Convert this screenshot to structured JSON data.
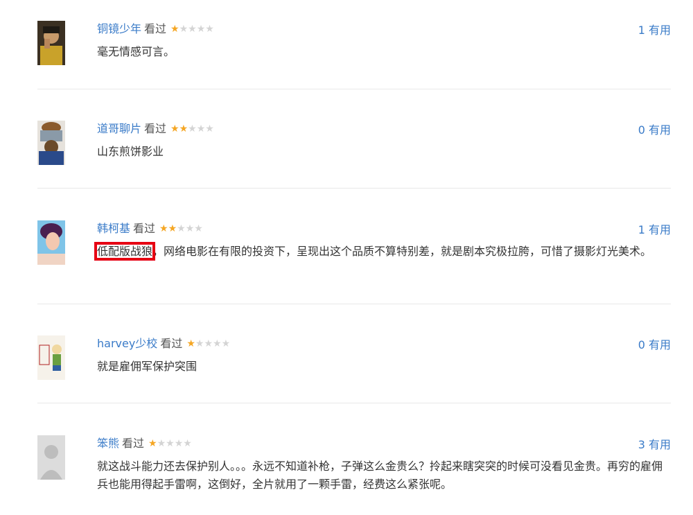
{
  "watched_label": "看过",
  "useful_label": "有用",
  "colors": {
    "link": "#3a7bc8",
    "star_on": "#f5a623",
    "star_off": "#d4d4d4",
    "highlight": "#e60012"
  },
  "reviews": [
    {
      "user": "铜镜少年",
      "rating": 1,
      "useful_count": "1",
      "text": "毫无情感可言。",
      "highlight": ""
    },
    {
      "user": "道哥聊片",
      "rating": 2,
      "useful_count": "0",
      "text": "山东煎饼影业",
      "highlight": ""
    },
    {
      "user": "韩柯基",
      "rating": 2,
      "useful_count": "1",
      "highlight": "低配版战狼",
      "text": "，网络电影在有限的投资下，呈现出这个品质不算特别差，就是剧本究极拉胯，可惜了摄影灯光美术。"
    },
    {
      "user": "harvey少校",
      "rating": 1,
      "useful_count": "0",
      "text": "就是雇佣军保护突围",
      "highlight": ""
    },
    {
      "user": "笨熊",
      "rating": 1,
      "useful_count": "3",
      "text": "就这战斗能力还去保护别人。。。永远不知道补枪，子弹这么金贵么？拎起来瞎突突的时候可没看见金贵。再穷的雇佣兵也能用得起手雷啊，这倒好，全片就用了一颗手雷，经费这么紧张呢。",
      "highlight": ""
    }
  ]
}
